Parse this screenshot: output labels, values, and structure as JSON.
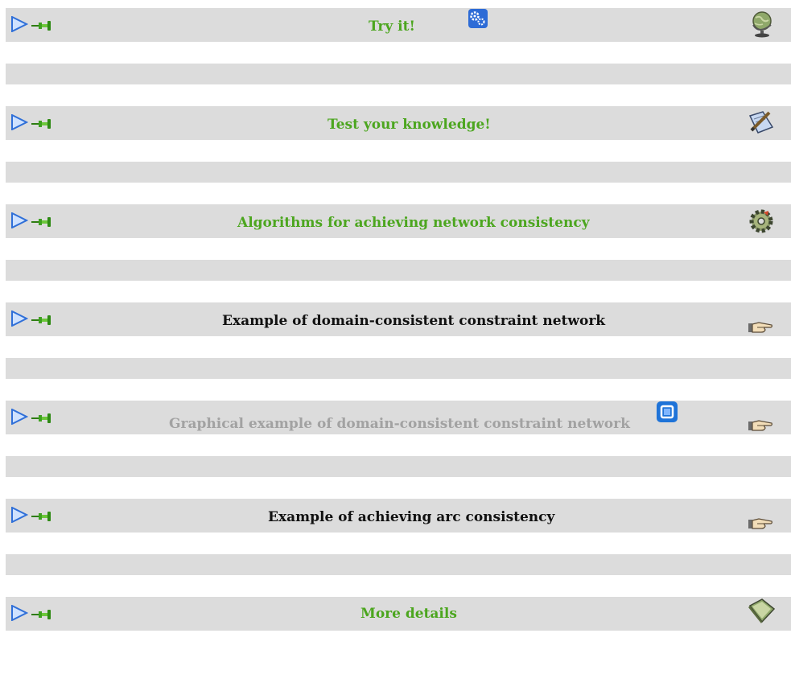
{
  "sections": [
    {
      "title": "Try it!",
      "title_color": "#4ca61f",
      "inline_icon": "gears-icon",
      "right_icon": "globe-icon"
    },
    {
      "title": "Test your knowledge!",
      "title_color": "#4ca61f",
      "right_icon": "pencil-paper-icon"
    },
    {
      "title": "Algorithms for achieving network consistency",
      "title_color": "#4ca61f",
      "right_icon": "cog-icon"
    },
    {
      "title": "Example of domain-consistent constraint network",
      "title_color": "#111111",
      "right_icon": "pointing-hand-icon"
    },
    {
      "title": "Graphical example of domain-consistent constraint network",
      "title_color": "#a2a2a2",
      "inline_icon": "window-icon",
      "right_icon": "pointing-hand-icon"
    },
    {
      "title": "Example of achieving arc consistency",
      "title_color": "#111111",
      "right_icon": "pointing-hand-icon"
    },
    {
      "title": "More details",
      "title_color": "#4ca61f",
      "right_icon": "book-icon"
    }
  ],
  "colors": {
    "header_bg": "#dcdcdc",
    "arrow": "#2f6fd8",
    "pin": "#3da01f"
  }
}
